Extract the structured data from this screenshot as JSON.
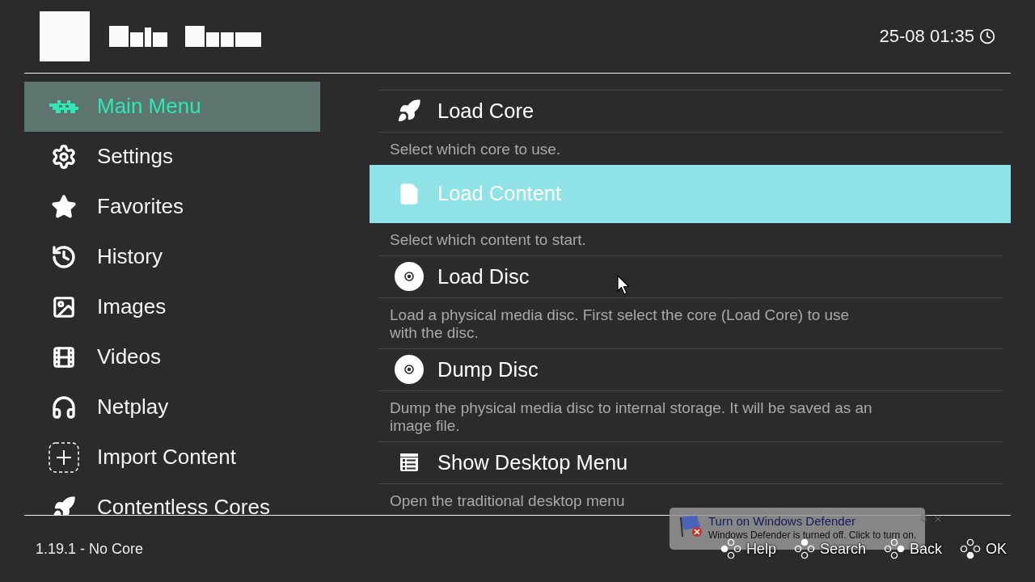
{
  "header": {
    "date_time": "25-08 01:35"
  },
  "sidebar": {
    "items": [
      {
        "label": "Main Menu",
        "kind": "invader",
        "selected": true
      },
      {
        "label": "Settings",
        "kind": "gear",
        "selected": false
      },
      {
        "label": "Favorites",
        "kind": "star",
        "selected": false
      },
      {
        "label": "History",
        "kind": "history",
        "selected": false
      },
      {
        "label": "Images",
        "kind": "image",
        "selected": false
      },
      {
        "label": "Videos",
        "kind": "video",
        "selected": false
      },
      {
        "label": "Netplay",
        "kind": "headset",
        "selected": false
      },
      {
        "label": "Import Content",
        "kind": "import",
        "selected": false
      },
      {
        "label": "Contentless Cores",
        "kind": "rocket",
        "selected": false
      }
    ]
  },
  "menu": {
    "items": [
      {
        "title": "Load Core",
        "description": "Select which core to use.",
        "kind": "rocket",
        "selected": false
      },
      {
        "title": "Load Content",
        "description": "Select which content to start.",
        "kind": "file",
        "selected": true
      },
      {
        "title": "Load Disc",
        "description": "Load a physical media disc. First select the core (Load Core) to use with the disc.",
        "kind": "disc",
        "selected": false
      },
      {
        "title": "Dump Disc",
        "description": "Dump the physical media disc to internal storage. It will be saved as an image file.",
        "kind": "disc",
        "selected": false
      },
      {
        "title": "Show Desktop Menu",
        "description": "Open the traditional desktop menu",
        "kind": "list",
        "selected": false
      }
    ]
  },
  "footer": {
    "version": "1.19.1 - No Core",
    "buttons": [
      {
        "label": "Help",
        "kind": "left"
      },
      {
        "label": "Search",
        "kind": "up"
      },
      {
        "label": "Back",
        "kind": "right"
      },
      {
        "label": "OK",
        "kind": "down"
      }
    ]
  },
  "notification": {
    "title": "Turn on Windows Defender",
    "message": "Windows Defender is turned off. Click to turn on."
  }
}
